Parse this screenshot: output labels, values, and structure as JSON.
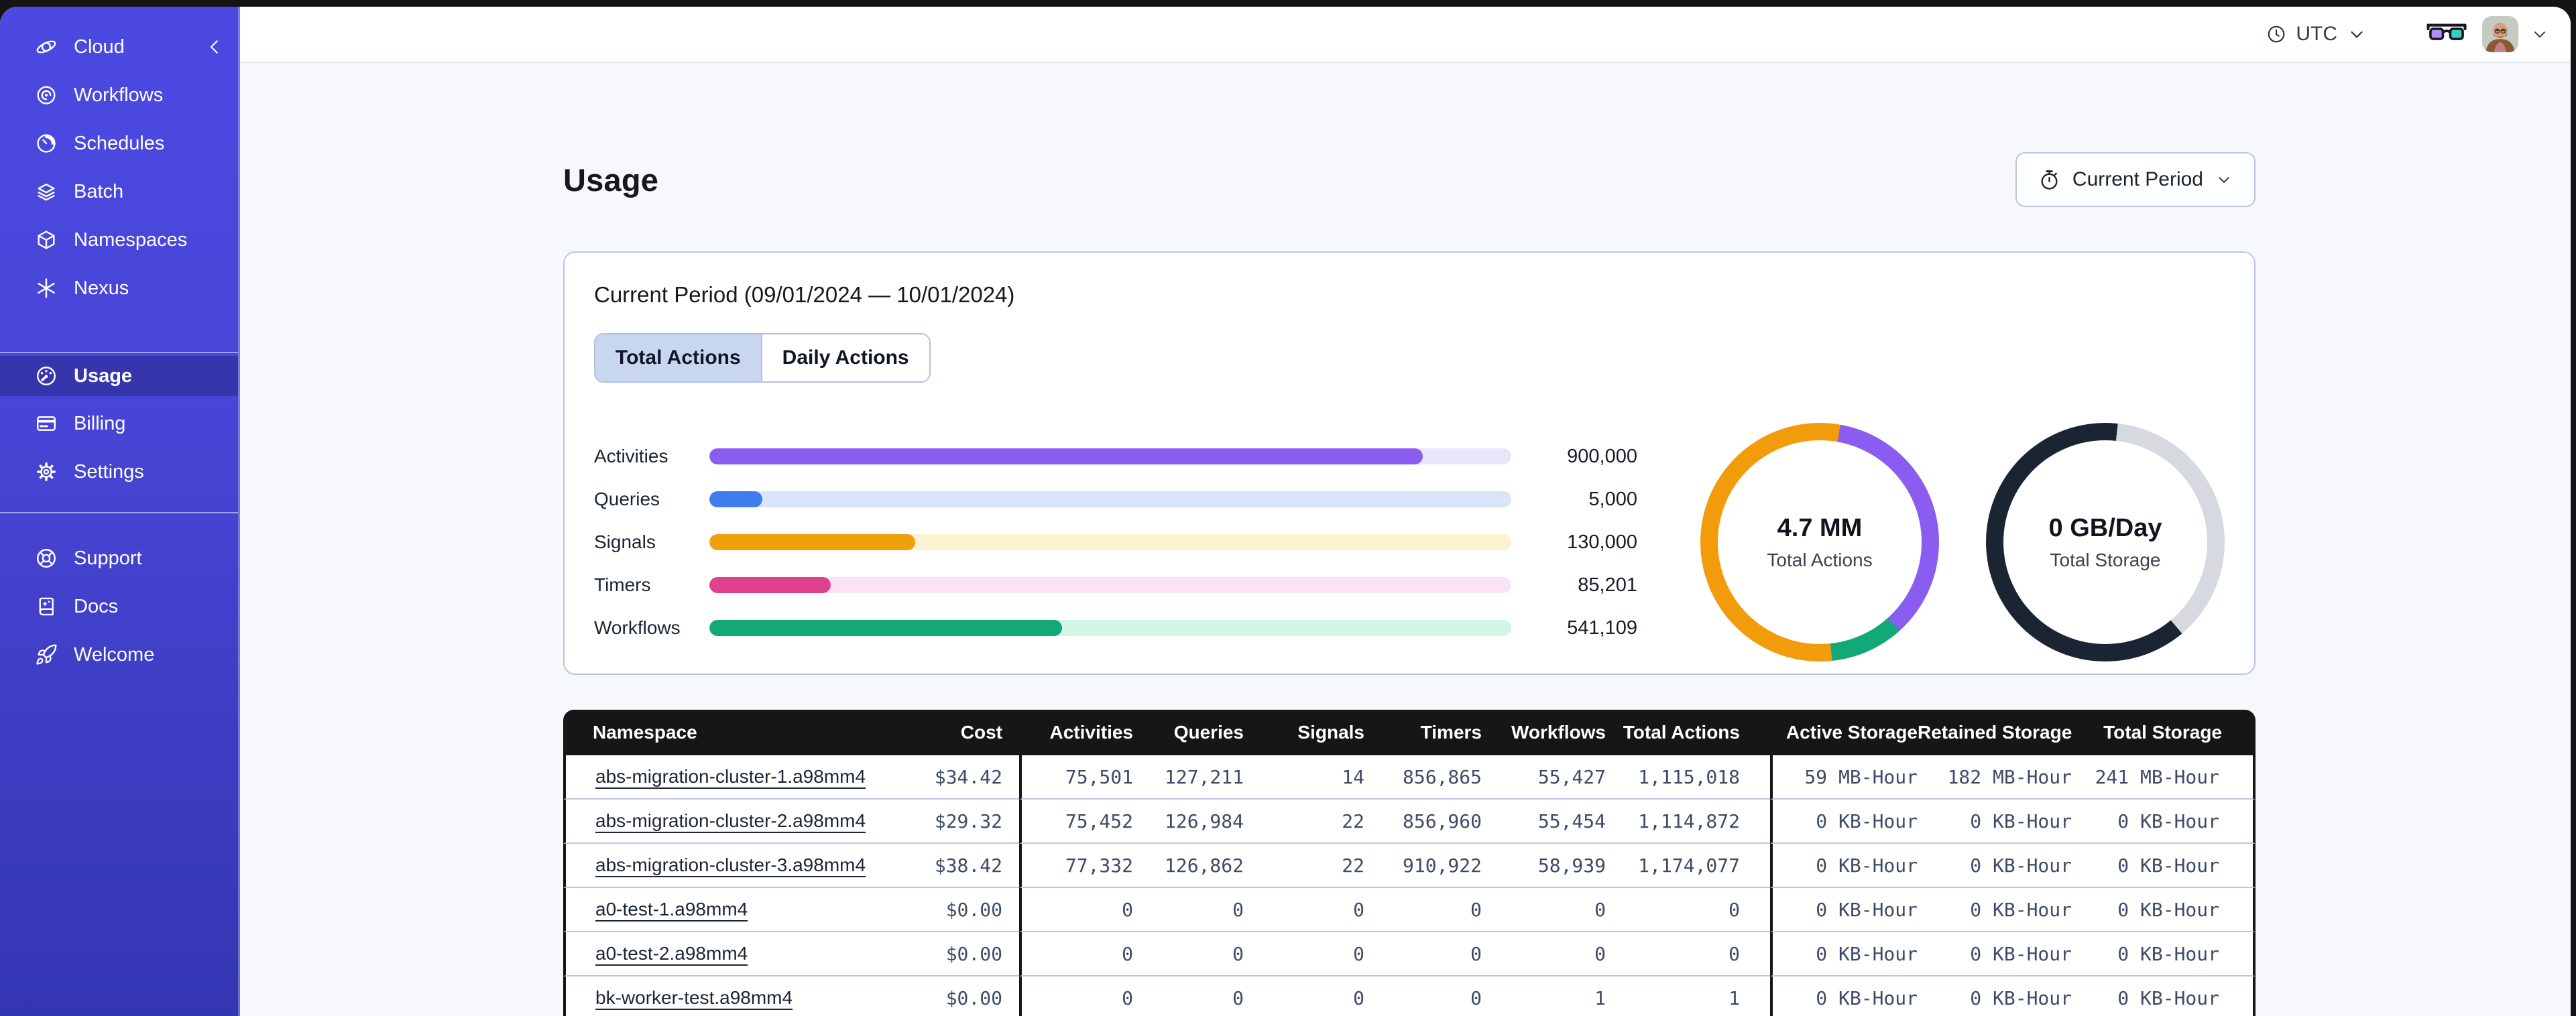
{
  "desktop": {
    "background": "#141414"
  },
  "sidebar": {
    "brand": {
      "label": "Cloud",
      "icon": "cloud-orbit-icon",
      "collapse_icon": "chevron-left-icon"
    },
    "colors": {
      "background_top": "#4b49e1",
      "background_bottom": "#3336b3",
      "active_item_overlay": "rgba(13,16,74,0.30)"
    },
    "groups": [
      {
        "id": "primary",
        "items": [
          {
            "id": "workflows",
            "label": "Workflows",
            "icon": "workflows-icon",
            "active": false
          },
          {
            "id": "schedules",
            "label": "Schedules",
            "icon": "schedules-clock-icon",
            "active": false
          },
          {
            "id": "batch",
            "label": "Batch",
            "icon": "batch-layers-icon",
            "active": false
          },
          {
            "id": "namespaces",
            "label": "Namespaces",
            "icon": "namespaces-cube-icon",
            "active": false
          },
          {
            "id": "nexus",
            "label": "Nexus",
            "icon": "nexus-asterisk-icon",
            "active": false
          }
        ]
      },
      {
        "id": "account",
        "items": [
          {
            "id": "usage",
            "label": "Usage",
            "icon": "usage-gauge-icon",
            "active": true
          },
          {
            "id": "billing",
            "label": "Billing",
            "icon": "billing-card-icon",
            "active": false
          },
          {
            "id": "settings",
            "label": "Settings",
            "icon": "settings-gear-icon",
            "active": false
          }
        ]
      },
      {
        "id": "resources",
        "items": [
          {
            "id": "support",
            "label": "Support",
            "icon": "support-lifering-icon",
            "active": false
          },
          {
            "id": "docs",
            "label": "Docs",
            "icon": "docs-book-icon",
            "active": false
          },
          {
            "id": "welcome",
            "label": "Welcome",
            "icon": "welcome-rocket-icon",
            "active": false
          }
        ]
      }
    ]
  },
  "topbar": {
    "timezone": {
      "label": "UTC",
      "icon": "clock-icon",
      "chevron": "chevron-down-icon"
    },
    "glasses_icon": "glasses-icon",
    "avatar": "user-avatar",
    "avatar_chevron": "chevron-down-icon"
  },
  "page": {
    "title": "Usage",
    "period_button": {
      "label": "Current Period",
      "icon": "stopwatch-icon",
      "chevron": "chevron-down-icon"
    }
  },
  "usage_card": {
    "title": "Current Period (09/01/2024 — 10/01/2024)",
    "tabs": [
      {
        "label": "Total Actions",
        "active": true
      },
      {
        "label": "Daily Actions",
        "active": false
      }
    ]
  },
  "chart_data": [
    {
      "type": "bar",
      "orientation": "horizontal",
      "categories": [
        "Activities",
        "Queries",
        "Signals",
        "Timers",
        "Workflows"
      ],
      "values": [
        900000,
        5000,
        130000,
        85201,
        541109
      ],
      "value_labels": [
        "900,000",
        "5,000",
        "130,000",
        "85,201",
        "541,109"
      ],
      "fill_fractions": [
        0.89,
        0.066,
        0.257,
        0.151,
        0.44
      ],
      "bar_colors": [
        "#8a5cf0",
        "#3f7cee",
        "#efa00b",
        "#e0418f",
        "#13a877"
      ],
      "track_colors": [
        "#eae6fa",
        "#d8e5f9",
        "#fdf2d0",
        "#fbe3f6",
        "#d2f6e3"
      ],
      "legend": "none",
      "grid": false
    },
    {
      "type": "donut",
      "center_value": "4.7 MM",
      "center_label": "Total Actions",
      "segments": [
        {
          "name": "signals-wrap",
          "color": "#f29c0c",
          "start_deg": 0,
          "end_deg": 10
        },
        {
          "name": "activities",
          "color": "#8a5cf0",
          "start_deg": 10,
          "end_deg": 138
        },
        {
          "name": "workflows",
          "color": "#13a877",
          "start_deg": 138,
          "end_deg": 174
        },
        {
          "name": "signals",
          "color": "#f29c0c",
          "start_deg": 174,
          "end_deg": 360
        }
      ]
    },
    {
      "type": "donut",
      "center_value": "0 GB/Day",
      "center_label": "Total Storage",
      "segments": [
        {
          "name": "used-wrap",
          "color": "#1b2433",
          "start_deg": 0,
          "end_deg": 6
        },
        {
          "name": "free",
          "color": "#d6d9e0",
          "start_deg": 6,
          "end_deg": 140
        },
        {
          "name": "used",
          "color": "#1b2433",
          "start_deg": 140,
          "end_deg": 360
        }
      ]
    }
  ],
  "table": {
    "columns": [
      {
        "label": "Namespace",
        "numeric": false
      },
      {
        "label": "Cost",
        "numeric": true
      },
      {
        "label": "Activities",
        "numeric": true
      },
      {
        "label": "Queries",
        "numeric": true
      },
      {
        "label": "Signals",
        "numeric": true
      },
      {
        "label": "Timers",
        "numeric": true
      },
      {
        "label": "Workflows",
        "numeric": true
      },
      {
        "label": "Total Actions",
        "numeric": true
      },
      {
        "label": "Active Storage",
        "numeric": true
      },
      {
        "label": "Retained Storage",
        "numeric": true
      },
      {
        "label": "Total Storage",
        "numeric": true
      }
    ],
    "rows": [
      {
        "cells": [
          "abs-migration-cluster-1.a98mm4",
          "$34.42",
          "75,501",
          "127,211",
          "14",
          "856,865",
          "55,427",
          "1,115,018",
          "59 MB-Hour",
          "182 MB-Hour",
          "241 MB-Hour"
        ]
      },
      {
        "cells": [
          "abs-migration-cluster-2.a98mm4",
          "$29.32",
          "75,452",
          "126,984",
          "22",
          "856,960",
          "55,454",
          "1,114,872",
          "0 KB-Hour",
          "0 KB-Hour",
          "0 KB-Hour"
        ]
      },
      {
        "cells": [
          "abs-migration-cluster-3.a98mm4",
          "$38.42",
          "77,332",
          "126,862",
          "22",
          "910,922",
          "58,939",
          "1,174,077",
          "0 KB-Hour",
          "0 KB-Hour",
          "0 KB-Hour"
        ]
      },
      {
        "cells": [
          "a0-test-1.a98mm4",
          "$0.00",
          "0",
          "0",
          "0",
          "0",
          "0",
          "0",
          "0 KB-Hour",
          "0 KB-Hour",
          "0 KB-Hour"
        ]
      },
      {
        "cells": [
          "a0-test-2.a98mm4",
          "$0.00",
          "0",
          "0",
          "0",
          "0",
          "0",
          "0",
          "0 KB-Hour",
          "0 KB-Hour",
          "0 KB-Hour"
        ]
      },
      {
        "cells": [
          "bk-worker-test.a98mm4",
          "$0.00",
          "0",
          "0",
          "0",
          "0",
          "1",
          "1",
          "0 KB-Hour",
          "0 KB-Hour",
          "0 KB-Hour"
        ]
      }
    ]
  }
}
